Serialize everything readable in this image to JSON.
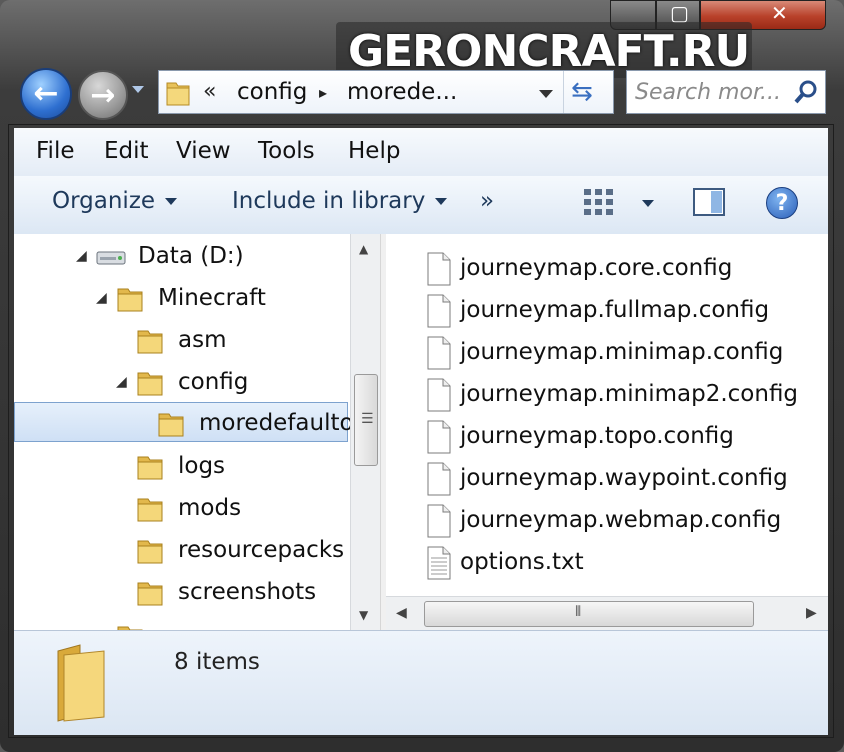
{
  "watermark": "GERONCRAFT.RU",
  "address": {
    "chevrons": "«",
    "segments": [
      "config",
      "morede..."
    ],
    "segment_sep": "▸"
  },
  "search": {
    "placeholder": "Search mor..."
  },
  "menu": [
    "File",
    "Edit",
    "View",
    "Tools",
    "Help"
  ],
  "toolbar": {
    "organize": "Organize",
    "include_in_library": "Include in library",
    "more": "»",
    "help": "?"
  },
  "tree": [
    {
      "label": "Data (D:)",
      "expander": "◢",
      "icon": "drive-icon"
    },
    {
      "label": "Minecraft",
      "expander": "◢",
      "icon": "folder-icon"
    },
    {
      "label": "asm",
      "expander": "",
      "icon": "folder-icon"
    },
    {
      "label": "config",
      "expander": "◢",
      "icon": "folder-icon"
    },
    {
      "label": "moredefaulto",
      "expander": "",
      "icon": "folder-icon",
      "selected": true
    },
    {
      "label": "logs",
      "expander": "",
      "icon": "folder-icon"
    },
    {
      "label": "mods",
      "expander": "",
      "icon": "folder-icon"
    },
    {
      "label": "resourcepacks",
      "expander": "",
      "icon": "folder-icon"
    },
    {
      "label": "screenshots",
      "expander": "",
      "icon": "folder-icon"
    }
  ],
  "files": [
    {
      "name": "journeymap.core.config",
      "icon": "file-icon"
    },
    {
      "name": "journeymap.fullmap.config",
      "icon": "file-icon"
    },
    {
      "name": "journeymap.minimap.config",
      "icon": "file-icon"
    },
    {
      "name": "journeymap.minimap2.config",
      "icon": "file-icon"
    },
    {
      "name": "journeymap.topo.config",
      "icon": "file-icon"
    },
    {
      "name": "journeymap.waypoint.config",
      "icon": "file-icon"
    },
    {
      "name": "journeymap.webmap.config",
      "icon": "file-icon"
    },
    {
      "name": "options.txt",
      "icon": "text-file-icon"
    }
  ],
  "status": {
    "item_count": "8 items"
  },
  "colors": {
    "accent": "#2e6fd0",
    "selection": "#cfe0f5",
    "close": "#b8412a"
  }
}
